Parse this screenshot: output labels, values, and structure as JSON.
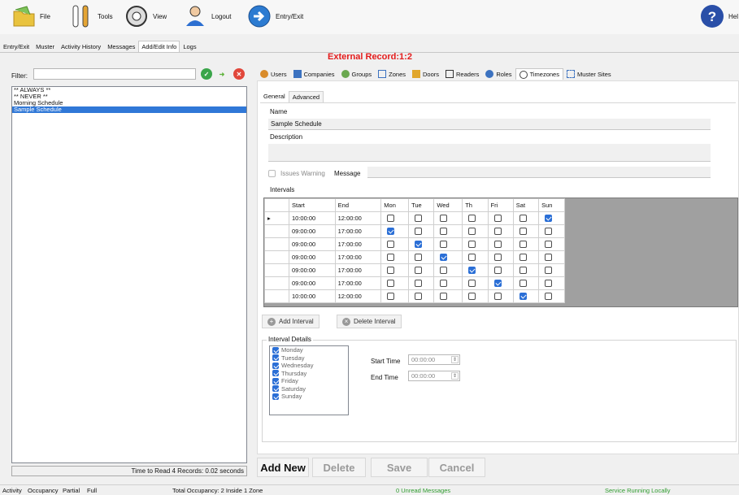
{
  "toolbar": {
    "file": "File",
    "tools": "Tools",
    "view": "View",
    "logout": "Logout",
    "entry_exit": "Entry/Exit",
    "help": "Hel"
  },
  "main_tabs": [
    "Entry/Exit",
    "Muster",
    "Activity History",
    "Messages",
    "Add/Edit Info",
    "Logs"
  ],
  "active_main_tab": "Add/Edit Info",
  "left": {
    "filter_label": "Filter:",
    "filter_value": "",
    "items": [
      "** ALWAYS **",
      "** NEVER **",
      "Morning Schedule",
      "Sample Schedule"
    ],
    "selected": "Sample Schedule",
    "status": "Time to Read 4 Records: 0.02 seconds"
  },
  "header": {
    "external_record": "External Record:1:2"
  },
  "sub_tabs": [
    "Users",
    "Companies",
    "Groups",
    "Zones",
    "Doors",
    "Readers",
    "Roles",
    "Timezones",
    "Muster Sites"
  ],
  "active_sub_tab": "Timezones",
  "form": {
    "inner_tabs": [
      "General",
      "Advanced"
    ],
    "name_label": "Name",
    "name_value": "Sample Schedule",
    "description_label": "Description",
    "description_value": "",
    "issues_warning_label": "Issues Warning",
    "message_label": "Message",
    "intervals_label": "Intervals"
  },
  "intervals": {
    "columns": [
      "Start",
      "End",
      "Mon",
      "Tue",
      "Wed",
      "Th",
      "Fri",
      "Sat",
      "Sun"
    ],
    "rows": [
      {
        "start": "10:00:00",
        "end": "12:00:00",
        "days": [
          false,
          false,
          false,
          false,
          false,
          false,
          true
        ]
      },
      {
        "start": "09:00:00",
        "end": "17:00:00",
        "days": [
          true,
          false,
          false,
          false,
          false,
          false,
          false
        ]
      },
      {
        "start": "09:00:00",
        "end": "17:00:00",
        "days": [
          false,
          true,
          false,
          false,
          false,
          false,
          false
        ]
      },
      {
        "start": "09:00:00",
        "end": "17:00:00",
        "days": [
          false,
          false,
          true,
          false,
          false,
          false,
          false
        ]
      },
      {
        "start": "09:00:00",
        "end": "17:00:00",
        "days": [
          false,
          false,
          false,
          true,
          false,
          false,
          false
        ]
      },
      {
        "start": "09:00:00",
        "end": "17:00:00",
        "days": [
          false,
          false,
          false,
          false,
          true,
          false,
          false
        ]
      },
      {
        "start": "10:00:00",
        "end": "12:00:00",
        "days": [
          false,
          false,
          false,
          false,
          false,
          true,
          false
        ]
      }
    ]
  },
  "buttons": {
    "add_interval": "Add Interval",
    "delete_interval": "Delete Interval",
    "add_new": "Add New",
    "delete": "Delete",
    "save": "Save",
    "cancel": "Cancel"
  },
  "interval_details": {
    "title": "Interval Details",
    "days": [
      "Monday",
      "Tuesday",
      "Wednesday",
      "Thursday",
      "Friday",
      "Saturday",
      "Sunday"
    ],
    "start_label": "Start Time",
    "start_value": "00:00:00",
    "end_label": "End Time",
    "end_value": "00:00:00"
  },
  "status_bar": {
    "tabs": [
      "Activity",
      "Occupancy",
      "Partial",
      "Full"
    ],
    "occupancy": "Total Occupancy: 2 Inside 1 Zone",
    "messages": "0 Unread Messages",
    "service": "Service Running Locally"
  },
  "colors": {
    "accent": "#3078d7",
    "record": "#e41b1b",
    "status_green": "#2e9b2e"
  }
}
